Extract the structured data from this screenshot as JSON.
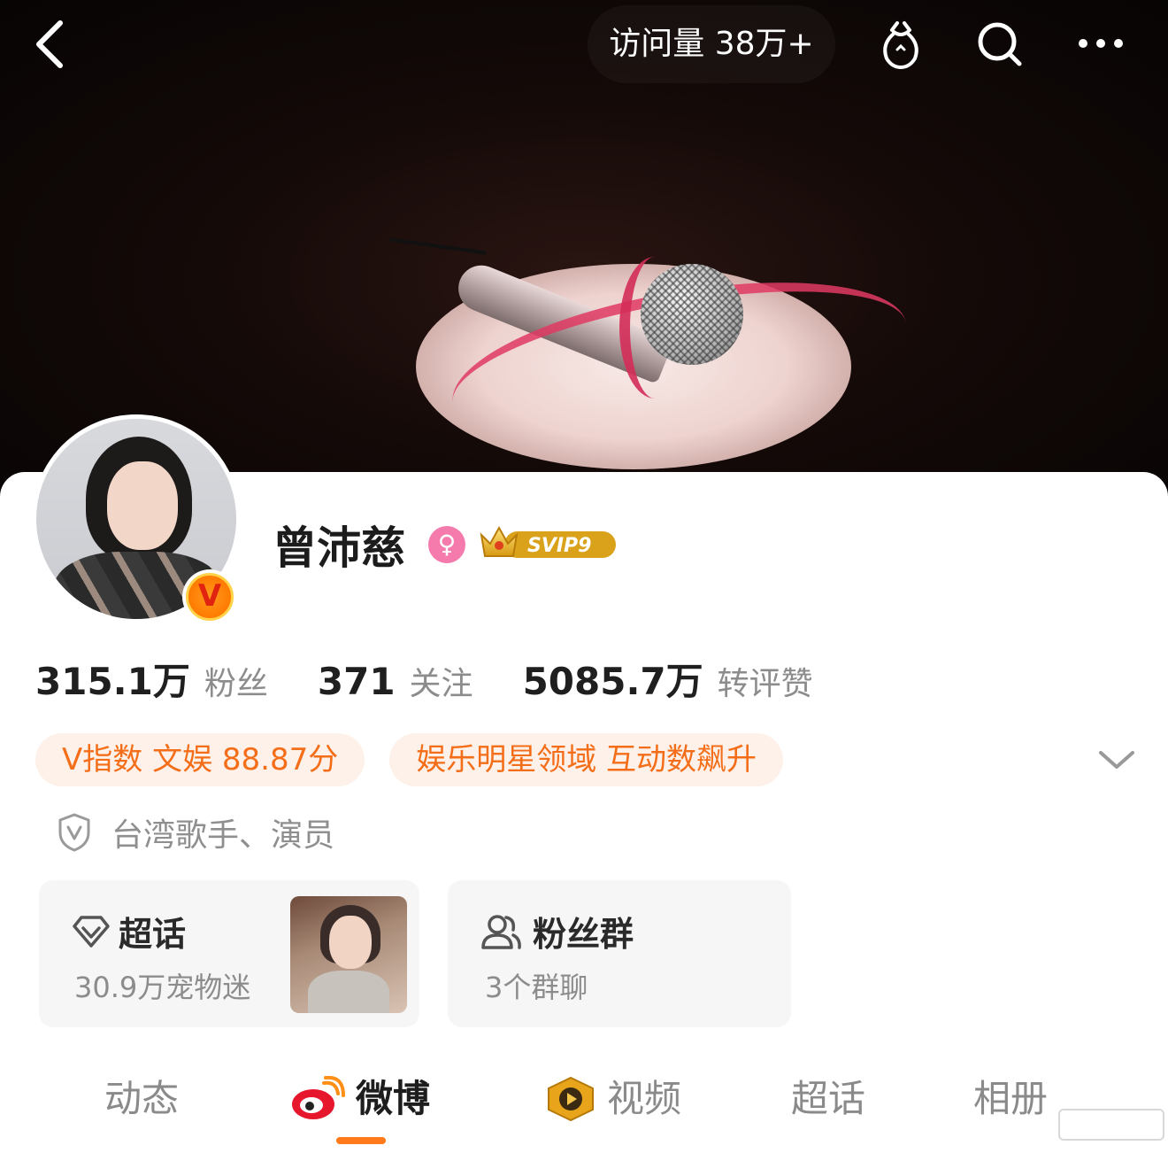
{
  "header": {
    "visits_label": "访问量 38万+",
    "icons": [
      "back-icon",
      "fortune-bag-icon",
      "search-icon",
      "more-icon"
    ]
  },
  "profile": {
    "name": "曾沛慈",
    "gender_icon": "female-icon",
    "gender_symbol": "♀",
    "svip_label": "SVIP9",
    "verified_badge": "V",
    "stats": [
      {
        "value": "315.1万",
        "label": "粉丝"
      },
      {
        "value": "371",
        "label": "关注"
      },
      {
        "value": "5085.7万",
        "label": "转评赞"
      }
    ],
    "tags": [
      "V指数 文娱 88.87分",
      "娱乐明星领域 互动数飙升"
    ],
    "verification": "台湾歌手、演员"
  },
  "boxes": {
    "supertopic": {
      "title": "超话",
      "sub": "30.9万宠物迷"
    },
    "fan_group": {
      "title": "粉丝群",
      "sub": "3个群聊"
    }
  },
  "tabs": [
    {
      "label": "动态",
      "active": false
    },
    {
      "label": "微博",
      "active": true
    },
    {
      "label": "视频",
      "active": false
    },
    {
      "label": "超话",
      "active": false
    },
    {
      "label": "相册",
      "active": false
    }
  ],
  "colors": {
    "accent": "#ff7a1a",
    "tag_text": "#f46e19",
    "tag_bg": "#fdf1e9",
    "gender": "#f47bac"
  }
}
